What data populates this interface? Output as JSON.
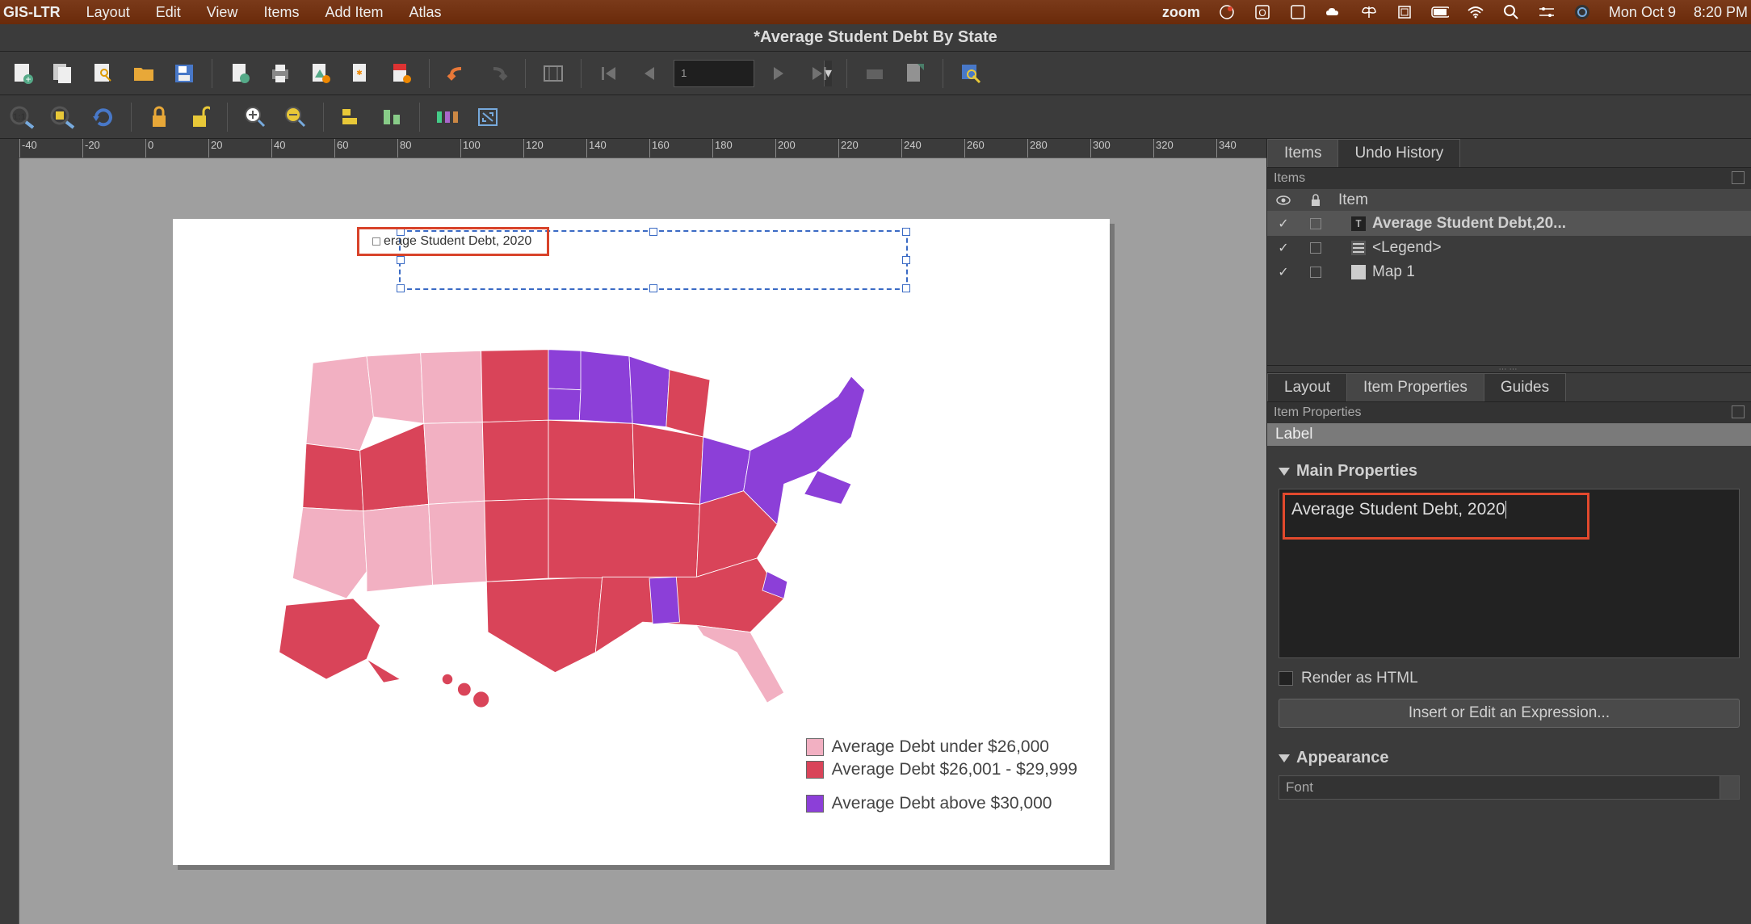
{
  "menubar": {
    "app": "GIS-LTR",
    "items": [
      "Layout",
      "Edit",
      "View",
      "Items",
      "Add Item",
      "Atlas"
    ],
    "right_label": "zoom",
    "date": "Mon Oct 9",
    "time": "8:20 PM"
  },
  "window": {
    "title": "*Average Student Debt By State"
  },
  "toolbar1_page_value": "1",
  "ruler_ticks": [
    -40,
    -20,
    0,
    20,
    40,
    60,
    80,
    100,
    120,
    140,
    160,
    180,
    200,
    220,
    240,
    260,
    280,
    300,
    320,
    340
  ],
  "canvas": {
    "title_text_visible": "erage Student Debt, 2020",
    "legend": {
      "items": [
        {
          "color": "#f2b0c2",
          "label": "Average Debt under $26,000"
        },
        {
          "color": "#d94459",
          "label": "Average Debt $26,001 - $29,999"
        },
        {
          "color": "#8c3fd8",
          "label": "Average Debt above $30,000"
        }
      ]
    }
  },
  "items_panel": {
    "tab_items": "Items",
    "tab_undo": "Undo History",
    "header": "Items",
    "col_item": "Item",
    "rows": [
      {
        "checked": true,
        "label": "Average Student Debt,20...",
        "icon": "text",
        "selected": true
      },
      {
        "checked": true,
        "label": "<Legend>",
        "icon": "legend",
        "selected": false
      },
      {
        "checked": true,
        "label": "Map 1",
        "icon": "map",
        "selected": false
      }
    ]
  },
  "props_panel": {
    "tab_layout": "Layout",
    "tab_item": "Item Properties",
    "tab_guides": "Guides",
    "header": "Item Properties",
    "section": "Label",
    "group_main": "Main Properties",
    "text_value": "Average Student Debt, 2020",
    "render_html": "Render as HTML",
    "insert_btn": "Insert or Edit an Expression...",
    "group_appearance": "Appearance",
    "font_label": "Font"
  }
}
